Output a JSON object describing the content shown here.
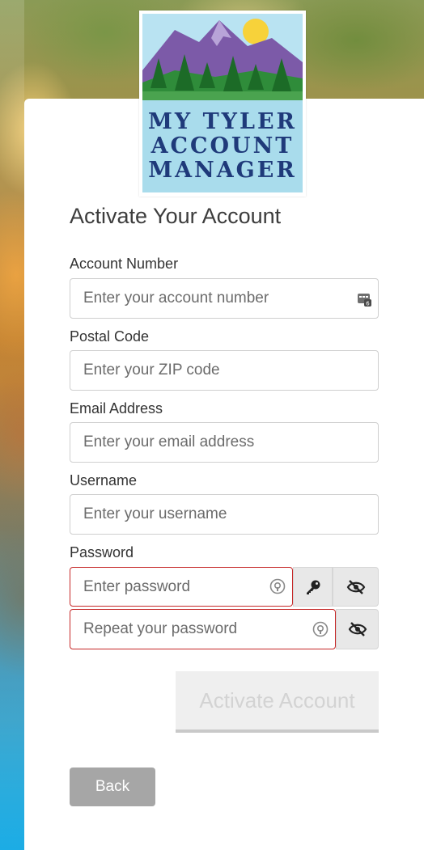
{
  "logo": {
    "line1": "MY TYLER",
    "line2": "ACCOUNT",
    "line3": "MANAGER"
  },
  "form": {
    "title": "Activate Your Account",
    "account_number": {
      "label": "Account Number",
      "placeholder": "Enter your account number"
    },
    "postal_code": {
      "label": "Postal Code",
      "placeholder": "Enter your ZIP code"
    },
    "email": {
      "label": "Email Address",
      "placeholder": "Enter your email address"
    },
    "username": {
      "label": "Username",
      "placeholder": "Enter your username"
    },
    "password": {
      "label": "Password",
      "placeholder": "Enter password",
      "repeat_placeholder": "Repeat your password"
    }
  },
  "buttons": {
    "activate": "Activate Account",
    "back": "Back"
  },
  "colors": {
    "error_border": "#c62828",
    "logo_text": "#1f3a7a",
    "logo_panel": "#a9dcec",
    "back_button": "#a6a6a6"
  },
  "icons": {
    "account_field": "id-card-icon",
    "password_field": "password-manager-icon",
    "generate": "key-icon",
    "toggle_visibility": "eye-slash-icon"
  }
}
